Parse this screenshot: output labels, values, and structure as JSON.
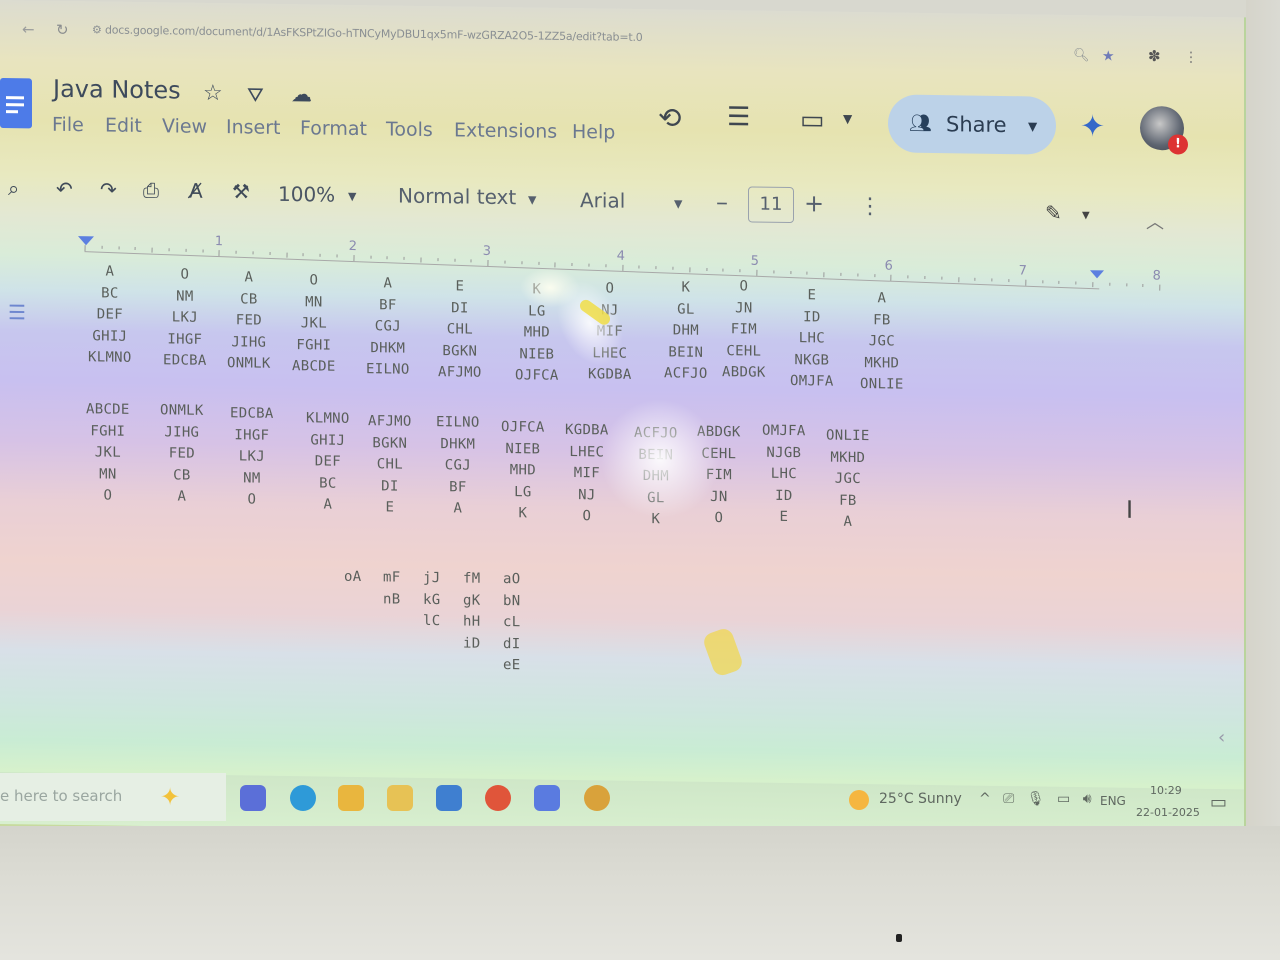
{
  "browser": {
    "url": "docs.google.com/document/d/1AsFKSPtZIGo-hTNCyMyDBU1qx5mF-wzGRZA2O5-1ZZ5a/edit?tab=t.0"
  },
  "doc": {
    "title": "Java Notes"
  },
  "menu": [
    "File",
    "Edit",
    "View",
    "Insert",
    "Format",
    "Tools",
    "Extensions",
    "Help"
  ],
  "share_label": "Share",
  "toolbar": {
    "zoom": "100%",
    "style": "Normal text",
    "font": "Arial",
    "font_size": "11",
    "minus": "–",
    "plus": "+"
  },
  "ruler_numbers": [
    "1",
    "2",
    "3",
    "4",
    "5",
    "6",
    "7",
    "8"
  ],
  "patterns_row1": [
    [
      "A",
      "BC",
      "DEF",
      "GHIJ",
      "KLMNO"
    ],
    [
      "O",
      "NM",
      "LKJ",
      "IHGF",
      "EDCBA"
    ],
    [
      "A",
      "CB",
      "FED",
      "JIHG",
      "ONMLK"
    ],
    [
      "O",
      "MN",
      "JKL",
      "FGHI",
      "ABCDE"
    ],
    [
      "A",
      "BF",
      "CGJ",
      "DHKM",
      "EILNO"
    ],
    [
      "E",
      "DI",
      "CHL",
      "BGKN",
      "AFJMO"
    ],
    [
      "K",
      "LG",
      "MHD",
      "NIEB",
      "OJFCA"
    ],
    [
      "O",
      "NJ",
      "MIF",
      "LHEC",
      "KGDBA"
    ],
    [
      "K",
      "GL",
      "DHM",
      "BEIN",
      "ACFJO"
    ],
    [
      "O",
      "JN",
      "FIM",
      "CEHL",
      "ABDGK"
    ],
    [
      "E",
      "ID",
      "LHC",
      "NKGB",
      "OMJFA"
    ],
    [
      "A",
      "FB",
      "JGC",
      "MKHD",
      "ONLIE"
    ]
  ],
  "patterns_row2": [
    [
      "ABCDE",
      "FGHI",
      "JKL",
      "MN",
      "O"
    ],
    [
      "ONMLK",
      "JIHG",
      "FED",
      "CB",
      "A"
    ],
    [
      "EDCBA",
      "IHGF",
      "LKJ",
      "NM",
      "O"
    ],
    [
      "KLMNO",
      "GHIJ",
      "DEF",
      "BC",
      "A"
    ],
    [
      "AFJMO",
      "BGKN",
      "CHL",
      "DI",
      "E"
    ],
    [
      "EILNO",
      "DHKM",
      "CGJ",
      "BF",
      "A"
    ],
    [
      "OJFCA",
      "NIEB",
      "MHD",
      "LG",
      "K"
    ],
    [
      "KGDBA",
      "LHEC",
      "MIF",
      "NJ",
      "O"
    ],
    [
      "ACFJO",
      "BEIN",
      "DHM",
      "GL",
      "K"
    ],
    [
      "ABDGK",
      "CEHL",
      "FIM",
      "JN",
      "O"
    ],
    [
      "OMJFA",
      "NJGB",
      "LHC",
      "ID",
      "E"
    ],
    [
      "ONLIE",
      "MKHD",
      "JGC",
      "FB",
      "A"
    ]
  ],
  "patterns_row3": [
    [
      "oA"
    ],
    [
      "mF",
      "nB"
    ],
    [
      "jJ",
      "kG",
      "lC"
    ],
    [
      "fM",
      "gK",
      "hH",
      "iD"
    ],
    [
      "aO",
      "bN",
      "cL",
      "dI",
      "eE"
    ]
  ],
  "taskbar": {
    "search_placeholder": "e here to search",
    "weather": "25°C  Sunny",
    "lang": "ENG",
    "time": "10:29",
    "date": "22-01-2025"
  },
  "colors": {
    "docs_blue": "#4d7be8",
    "share_bg": "#bcd2e8",
    "alert": "#dd3333"
  },
  "icons": [
    "back-icon",
    "reload-icon",
    "zoom-icon",
    "bookmark-icon",
    "star-icon",
    "move-icon",
    "cloud-icon",
    "history-icon",
    "comment-icon",
    "meet-icon",
    "gemini-icon",
    "search-icon",
    "undo-icon",
    "redo-icon",
    "print-icon",
    "spellcheck-icon",
    "paint-format-icon",
    "pencil-icon",
    "outline-icon"
  ]
}
